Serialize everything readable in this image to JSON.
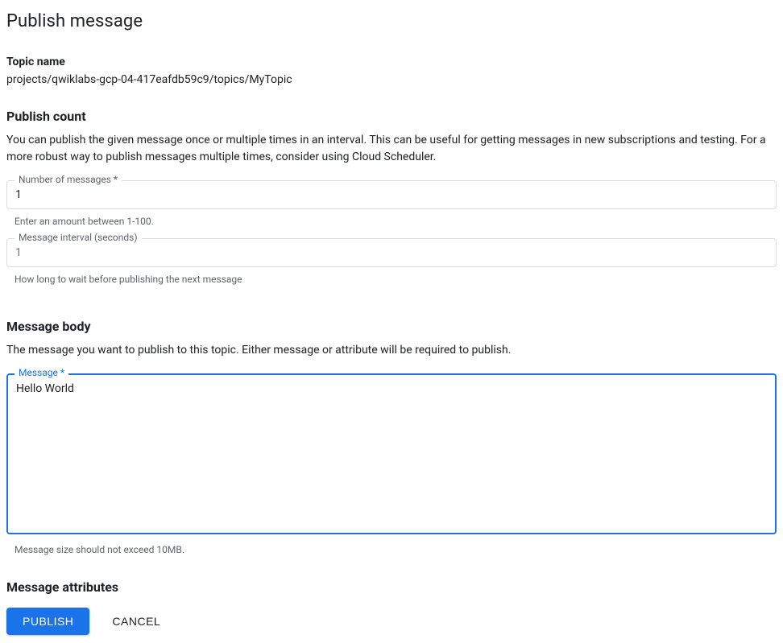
{
  "page": {
    "title": "Publish message"
  },
  "topic": {
    "label": "Topic name",
    "value": "projects/qwiklabs-gcp-04-417eafdb59c9/topics/MyTopic"
  },
  "publishCount": {
    "heading": "Publish count",
    "description": "You can publish the given message once or multiple times in an interval. This can be useful for getting messages in new subscriptions and testing. For a more robust way to publish messages multiple times, consider using Cloud Scheduler.",
    "numMessages": {
      "label": "Number of messages *",
      "value": "1",
      "helper": "Enter an amount between 1-100."
    },
    "interval": {
      "label": "Message interval (seconds)",
      "placeholder": "1",
      "helper": "How long to wait before publishing the next message"
    }
  },
  "messageBody": {
    "heading": "Message body",
    "description": "The message you want to publish to this topic. Either message or attribute will be required to publish.",
    "field": {
      "label": "Message *",
      "value": "Hello World",
      "helper": "Message size should not exceed 10MB."
    }
  },
  "messageAttributes": {
    "heading": "Message attributes"
  },
  "footer": {
    "publish": "Publish",
    "cancel": "Cancel"
  }
}
